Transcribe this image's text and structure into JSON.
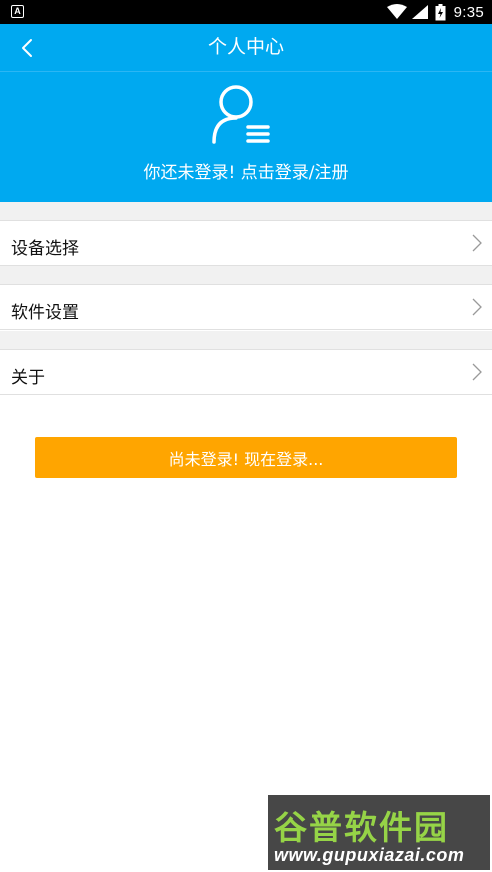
{
  "status_bar": {
    "notification_icon": "A",
    "icons": [
      "wifi-icon",
      "signal-icon",
      "battery-icon"
    ],
    "time": "9:35"
  },
  "title_bar": {
    "title": "个人中心",
    "back_icon": "chevron-left-icon"
  },
  "profile": {
    "avatar_icon": "user-list-icon",
    "login_prompt": "你还未登录! 点击登录/注册"
  },
  "menu": {
    "items": [
      {
        "label": "设备选择",
        "icon": "chevron-right-icon"
      },
      {
        "label": "软件设置",
        "icon": "chevron-right-icon"
      },
      {
        "label": "关于",
        "icon": "chevron-right-icon"
      }
    ]
  },
  "login_button": {
    "label": "尚未登录! 现在登录..."
  },
  "watermark": {
    "title": "谷普软件园",
    "url": "www.gupuxiazai.com"
  },
  "colors": {
    "primary": "#00a9f0",
    "accent": "#ffa500",
    "background": "#ffffff",
    "divider": "#e0e0e0"
  }
}
